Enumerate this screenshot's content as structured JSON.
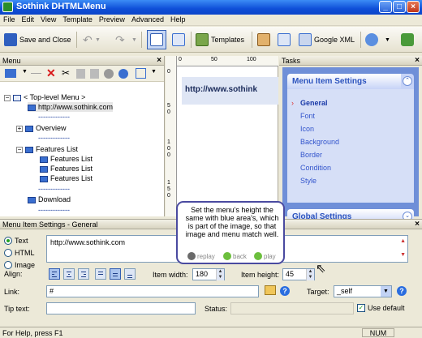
{
  "window": {
    "title": "Sothink DHTMLMenu"
  },
  "menubar": [
    "File",
    "Edit",
    "View",
    "Template",
    "Preview",
    "Advanced",
    "Help"
  ],
  "toolbar": {
    "save_close": "Save and Close",
    "templates": "Templates",
    "google_xml": "Google XML"
  },
  "menu_pane": {
    "title": "Menu",
    "tree": [
      {
        "label": "< Top-level Menu >"
      },
      {
        "label": "http://www.sothink.com"
      },
      {
        "label": "-------------"
      },
      {
        "label": "Overview"
      },
      {
        "label": "-------------"
      },
      {
        "label": "Features List"
      },
      {
        "label": "Features List"
      },
      {
        "label": "Features List"
      },
      {
        "label": "Features List"
      },
      {
        "label": "-------------"
      },
      {
        "label": "Download"
      },
      {
        "label": "-------------"
      }
    ]
  },
  "preview": {
    "ruler_top": [
      "0",
      "50",
      "100"
    ],
    "ruler_left": [
      "0",
      "5",
      "0",
      "1",
      "0",
      "0",
      "1",
      "5",
      "0"
    ],
    "item_text": "http://www.sothink"
  },
  "tasks_pane": {
    "title": "Tasks",
    "section1": "Menu Item Settings",
    "links": [
      "General",
      "Font",
      "Icon",
      "Background",
      "Border",
      "Condition",
      "Style"
    ],
    "section2": "Global Settings"
  },
  "tooltip": {
    "text": "Set the menu's height the same with blue area's, which is part of the image, so that image and menu match well.",
    "replay": "replay",
    "back": "back",
    "play": "play"
  },
  "settings": {
    "title": "Menu Item Settings - General",
    "radio_text": "Text",
    "radio_html": "HTML",
    "radio_image": "Image",
    "text_value": "http://www.sothink.com",
    "align_label": "Align:",
    "item_width_label": "Item width:",
    "item_width": "180",
    "item_height_label": "Item height:",
    "item_height": "45",
    "link_label": "Link:",
    "link_value": "#",
    "target_label": "Target:",
    "target_value": "_self",
    "tip_label": "Tip text:",
    "tip_value": "",
    "status_label": "Status:",
    "status_value": "",
    "use_default": "Use default"
  },
  "statusbar": {
    "left": "For Help, press F1",
    "num": "NUM"
  },
  "colors": {
    "accent": "#0f4fd8",
    "task_panel": "#6f8fd8",
    "task_header": "#2a52be"
  }
}
